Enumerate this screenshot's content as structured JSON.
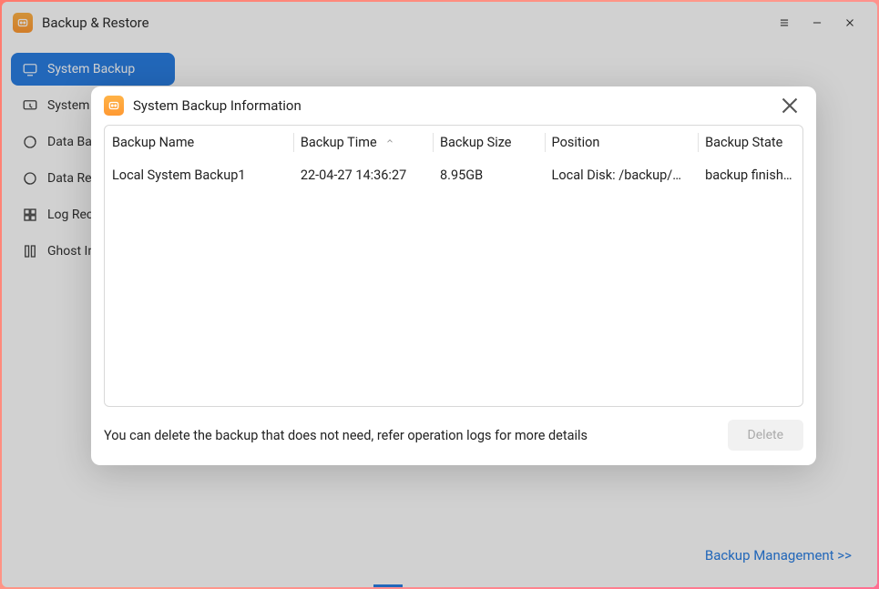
{
  "app": {
    "title": "Backup & Restore"
  },
  "sidebar": {
    "items": [
      {
        "label": "System Backup",
        "active": true
      },
      {
        "label": "System Restore"
      },
      {
        "label": "Data Backup"
      },
      {
        "label": "Data Restore"
      },
      {
        "label": "Log Records"
      },
      {
        "label": "Ghost Image"
      }
    ]
  },
  "main": {
    "management_link": "Backup Management >>"
  },
  "dialog": {
    "title": "System Backup Information",
    "columns": {
      "name": "Backup Name",
      "time": "Backup Time",
      "size": "Backup Size",
      "position": "Position",
      "state": "Backup State"
    },
    "rows": [
      {
        "name": "Local System Backup1",
        "time": "22-04-27 14:36:27",
        "size": "8.95GB",
        "position": "Local Disk: /backup/…",
        "state": "backup finished"
      }
    ],
    "footer_note": "You can delete the backup that does not need, refer operation logs for more details",
    "delete_label": "Delete"
  }
}
